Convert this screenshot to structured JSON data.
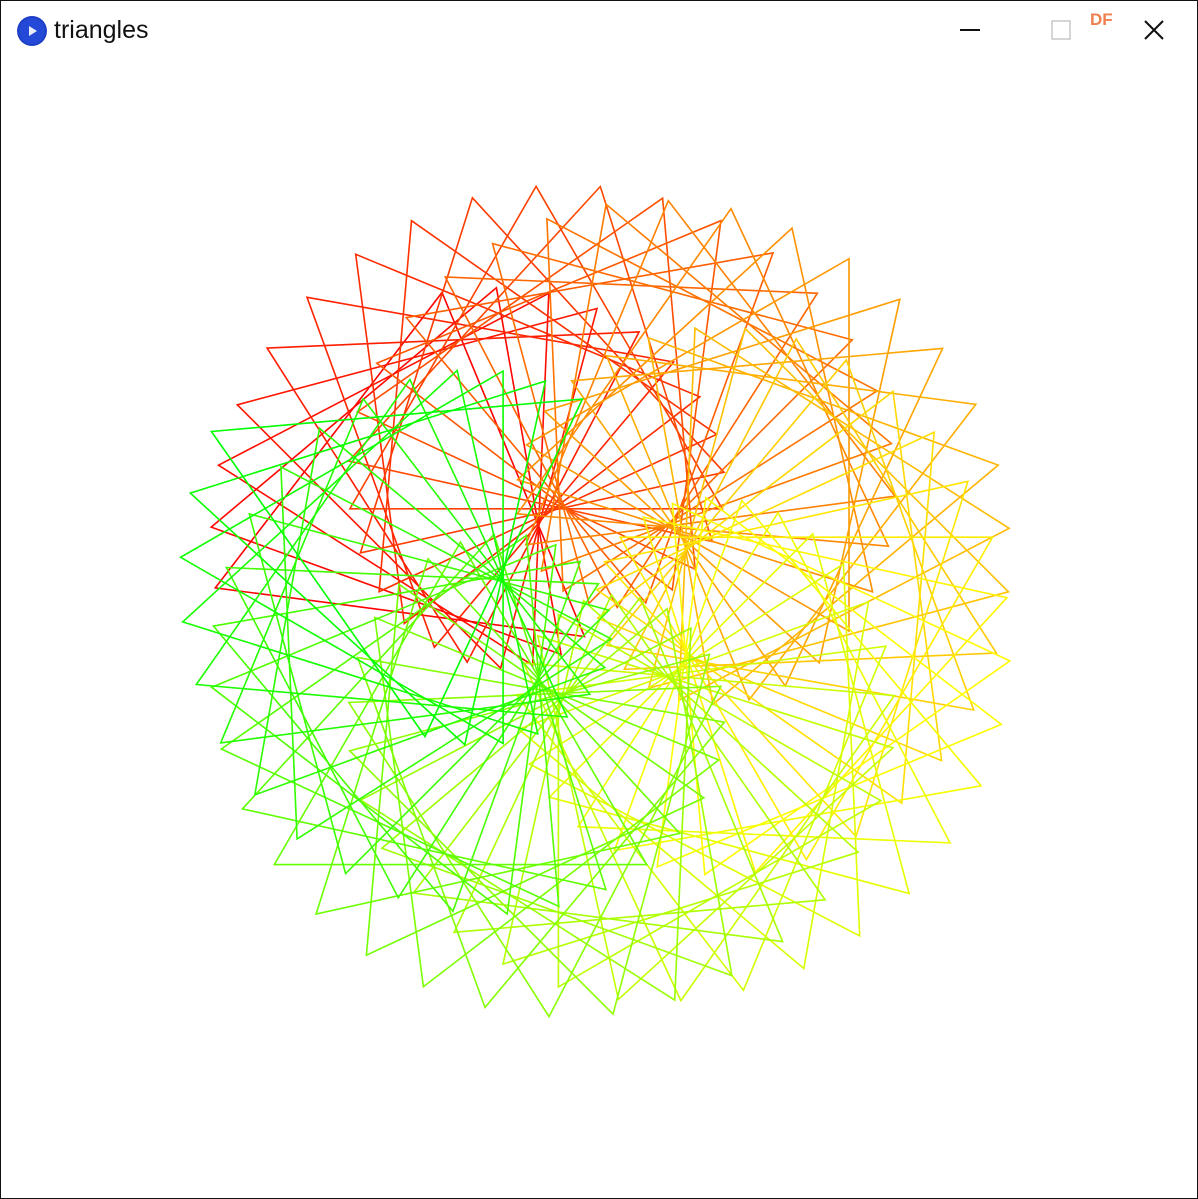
{
  "window": {
    "title": "triangles",
    "badge": "DF",
    "icons": {
      "app": "processing-play-icon",
      "minimize": "minimize-icon",
      "maximize": "maximize-icon",
      "close": "close-icon"
    }
  },
  "sketch": {
    "triangle_count": 72,
    "color_gradient": [
      "#ff0000",
      "#ff8000",
      "#ffff00",
      "#80ff00",
      "#00ff00"
    ],
    "background": "#ffffff"
  }
}
